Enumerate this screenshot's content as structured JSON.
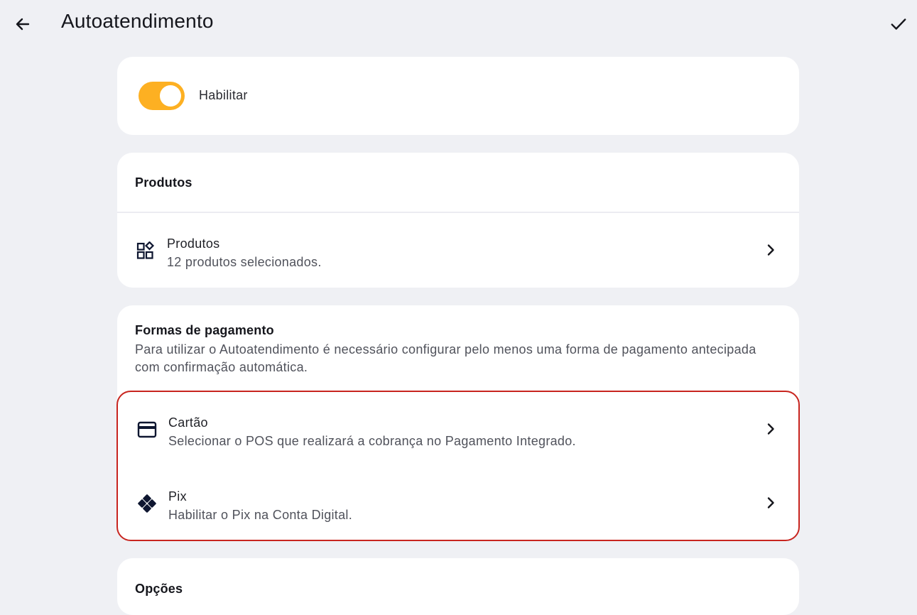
{
  "header": {
    "title": "Autoatendimento",
    "back_icon": "arrow-left-icon",
    "confirm_icon": "check-icon"
  },
  "enable": {
    "label": "Habilitar",
    "enabled": true,
    "accent_color": "#fdb022"
  },
  "products_section": {
    "title": "Produtos",
    "row": {
      "icon": "products-grid-icon",
      "title": "Produtos",
      "subtitle": "12 produtos selecionados."
    }
  },
  "payment_section": {
    "title": "Formas de pagamento",
    "description": "Para utilizar o Autoatendimento é necessário configurar pelo menos uma forma de pagamento antecipada com confirmação automática.",
    "highlight_color": "#c8251f",
    "items": [
      {
        "icon": "credit-card-icon",
        "title": "Cartão",
        "subtitle": "Selecionar o POS que realizará a cobrança no Pagamento Integrado."
      },
      {
        "icon": "pix-icon",
        "title": "Pix",
        "subtitle": "Habilitar o Pix na Conta Digital."
      }
    ]
  },
  "options_section": {
    "title": "Opções"
  }
}
